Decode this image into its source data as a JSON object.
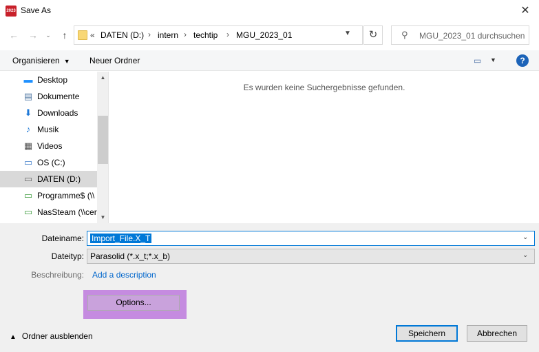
{
  "window": {
    "title": "Save As",
    "app_icon_text": "2023",
    "close_glyph": "✕"
  },
  "nav": {
    "back_glyph": "←",
    "forward_glyph": "→",
    "up_glyph": "↑"
  },
  "address": {
    "overflow": "«",
    "crumbs": [
      "DATEN (D:)",
      "intern",
      "techtip",
      "MGU_2023_01"
    ],
    "separator": "›"
  },
  "search": {
    "placeholder": "MGU_2023_01 durchsuchen"
  },
  "toolbar": {
    "organize": "Organisieren",
    "new_folder": "Neuer Ordner",
    "help": "?"
  },
  "sidebar": {
    "items": [
      {
        "label": "Desktop",
        "icon": "desktop-icon"
      },
      {
        "label": "Dokumente",
        "icon": "documents-icon"
      },
      {
        "label": "Downloads",
        "icon": "downloads-icon"
      },
      {
        "label": "Musik",
        "icon": "music-icon"
      },
      {
        "label": "Videos",
        "icon": "videos-icon"
      },
      {
        "label": "OS (C:)",
        "icon": "drive-icon"
      },
      {
        "label": "DATEN (D:)",
        "icon": "drive-icon"
      },
      {
        "label": "Programme$ (\\\\",
        "icon": "network-drive-icon"
      },
      {
        "label": "NasSteam (\\\\cer",
        "icon": "network-drive-icon"
      }
    ],
    "selected_index": 6
  },
  "content": {
    "empty_message": "Es wurden keine Suchergebnisse gefunden."
  },
  "form": {
    "filename_label": "Dateiname:",
    "filename_value": "Import_File.X_T",
    "filetype_label": "Dateityp:",
    "filetype_value": "Parasolid (*.x_t;*.x_b)",
    "description_label": "Beschreibung:",
    "description_link": "Add a description",
    "options_button": "Options..."
  },
  "footer": {
    "hide_folders": "Ordner ausblenden",
    "save": "Speichern",
    "cancel": "Abbrechen"
  },
  "colors": {
    "accent": "#0078d7",
    "options_highlight": "#c58be0",
    "link": "#0066cc"
  }
}
